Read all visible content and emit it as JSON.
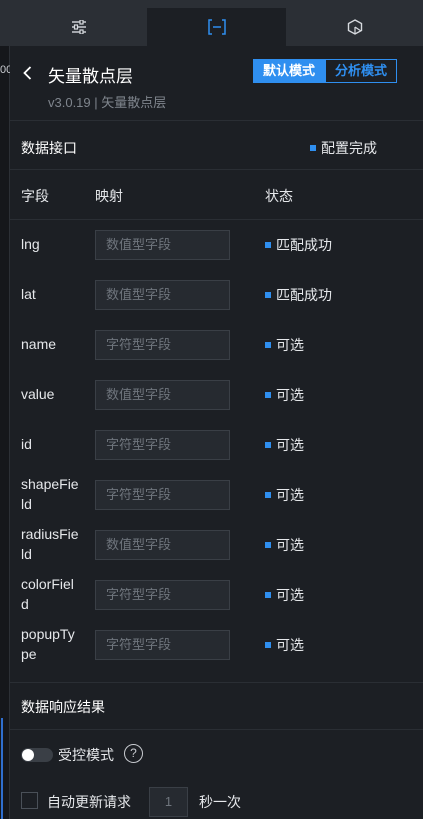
{
  "leftstrip": {
    "value": "00"
  },
  "header": {
    "title": "矢量散点层",
    "version": "v3.0.19 | 矢量散点层",
    "modes": [
      "默认模式",
      "分析模式"
    ]
  },
  "data_interface": {
    "title": "数据接口",
    "status": "配置完成",
    "columns": {
      "field": "字段",
      "mapping": "映射",
      "status": "状态"
    },
    "fields": [
      {
        "name": "lng",
        "placeholder": "数值型字段",
        "status": "匹配成功"
      },
      {
        "name": "lat",
        "placeholder": "数值型字段",
        "status": "匹配成功"
      },
      {
        "name": "name",
        "placeholder": "字符型字段",
        "status": "可选"
      },
      {
        "name": "value",
        "placeholder": "数值型字段",
        "status": "可选"
      },
      {
        "name": "id",
        "placeholder": "字符型字段",
        "status": "可选"
      },
      {
        "name": "shapeField",
        "placeholder": "字符型字段",
        "status": "可选"
      },
      {
        "name": "radiusField",
        "placeholder": "数值型字段",
        "status": "可选"
      },
      {
        "name": "colorField",
        "placeholder": "字符型字段",
        "status": "可选"
      },
      {
        "name": "popupType",
        "placeholder": "字符型字段",
        "status": "可选"
      }
    ]
  },
  "response": {
    "title": "数据响应结果",
    "controlled_label": "受控模式",
    "help": "?",
    "auto_update_label": "自动更新请求",
    "interval_value": "1",
    "interval_unit": "秒一次"
  },
  "colors": {
    "accent": "#2f8ff0",
    "panel": "#1c1f24",
    "topbar": "#2b2f35"
  },
  "icons": [
    "sliders-icon",
    "bracket-minus-icon",
    "cube-icon",
    "chevron-left-icon",
    "question-circle-icon"
  ]
}
